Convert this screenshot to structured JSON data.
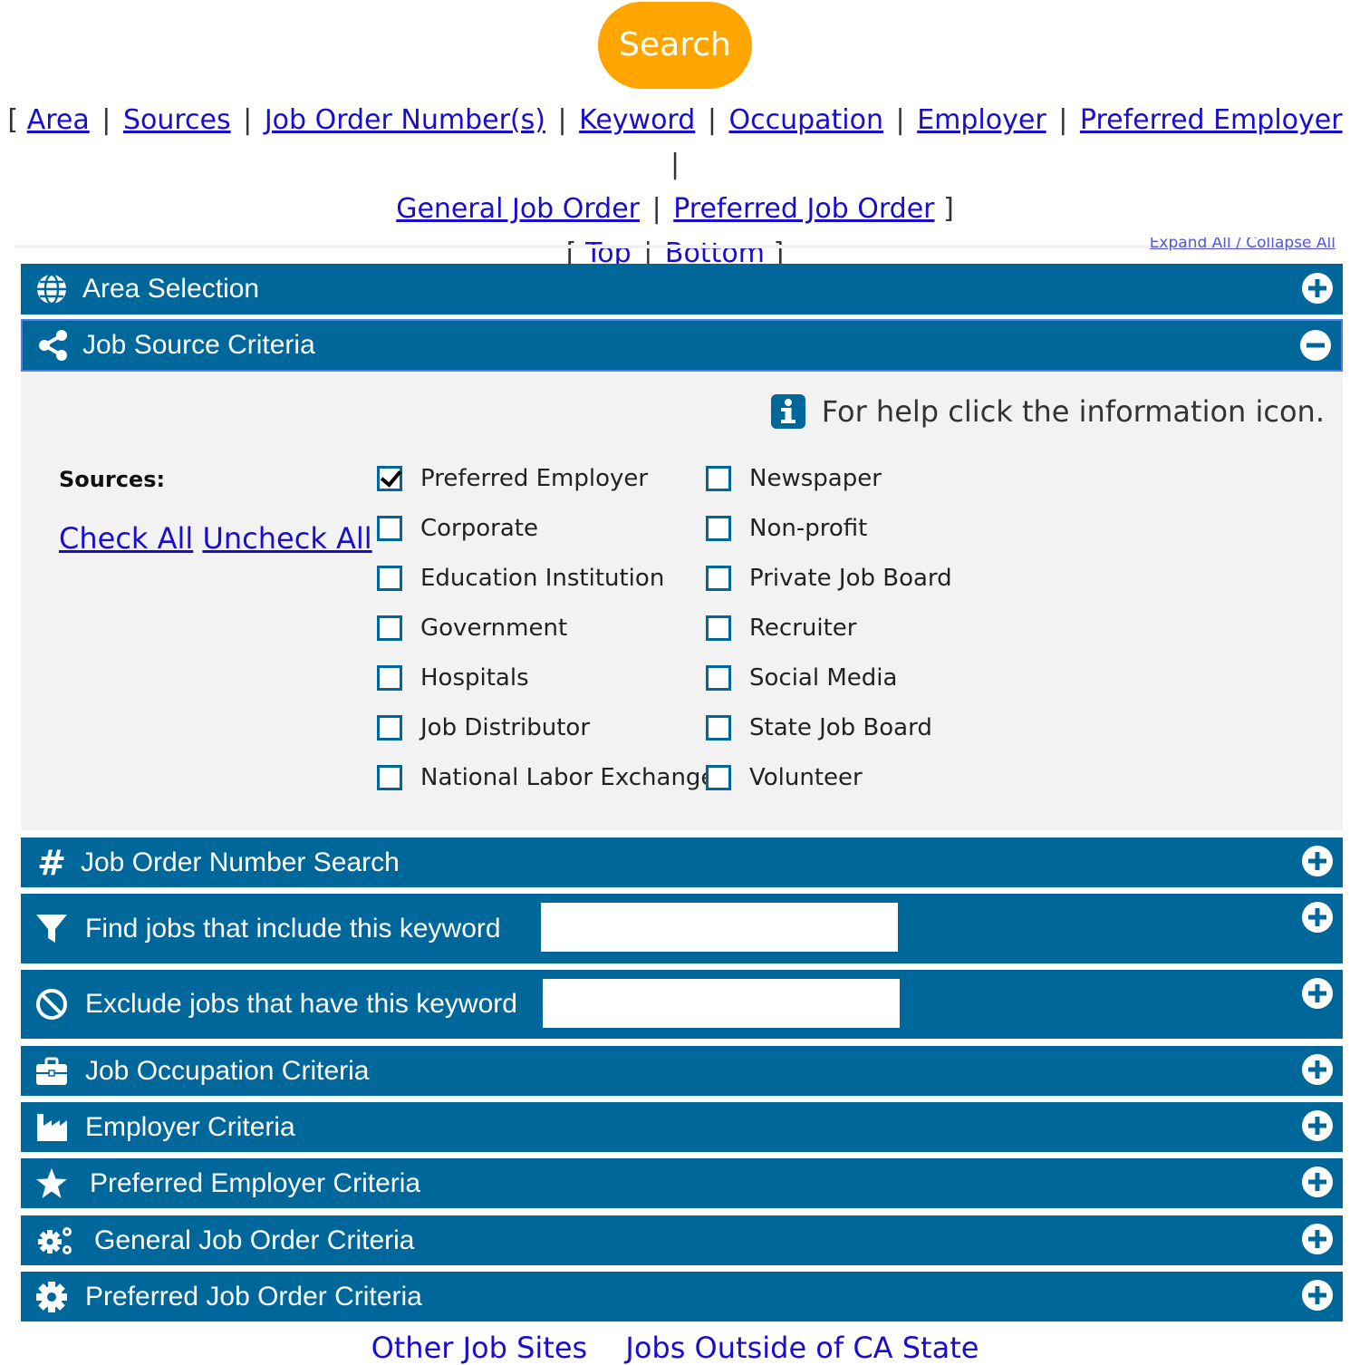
{
  "search_button": "Search",
  "nav": {
    "row1": [
      "Area",
      "Sources",
      "Job Order Number(s)",
      "Keyword",
      "Occupation",
      "Employer",
      "Preferred Employer"
    ],
    "row2": [
      "General Job Order",
      "Preferred Job Order"
    ],
    "row3": [
      "Top",
      "Bottom"
    ],
    "open_bracket": "[",
    "close_bracket": "]",
    "separator": "|"
  },
  "expand_collapse": "Expand All / Collapse All",
  "panels": {
    "area": {
      "title": "Area Selection",
      "icon": "globe-icon"
    },
    "job_source": {
      "title": "Job Source Criteria",
      "icon": "share-icon",
      "expanded": true
    },
    "job_order_number": {
      "title": "Job Order Number Search",
      "icon": "hash-icon"
    },
    "include_keyword": {
      "title": "Find jobs that include this keyword",
      "icon": "filter-icon",
      "value": ""
    },
    "exclude_keyword": {
      "title": "Exclude jobs that have this keyword",
      "icon": "ban-icon",
      "value": ""
    },
    "occupation": {
      "title": "Job Occupation Criteria",
      "icon": "briefcase-icon"
    },
    "employer": {
      "title": "Employer Criteria",
      "icon": "industry-icon"
    },
    "preferred_employer": {
      "title": "Preferred Employer Criteria",
      "icon": "star-icon"
    },
    "general_job_order": {
      "title": "General Job Order Criteria",
      "icon": "cogs-icon"
    },
    "preferred_job_order": {
      "title": "Preferred Job Order Criteria",
      "icon": "gear-icon"
    }
  },
  "job_source_body": {
    "help_text": "For help click the information icon.",
    "sources_label": "Sources:",
    "check_all": "Check All",
    "uncheck_all": "Uncheck All",
    "sources_col1": [
      {
        "label": "Preferred Employer",
        "checked": true
      },
      {
        "label": "Corporate",
        "checked": false
      },
      {
        "label": "Education Institution",
        "checked": false
      },
      {
        "label": "Government",
        "checked": false
      },
      {
        "label": "Hospitals",
        "checked": false
      },
      {
        "label": "Job Distributor",
        "checked": false
      },
      {
        "label": "National Labor Exchange",
        "checked": false
      }
    ],
    "sources_col2": [
      {
        "label": "Newspaper",
        "checked": false
      },
      {
        "label": "Non-profit",
        "checked": false
      },
      {
        "label": "Private Job Board",
        "checked": false
      },
      {
        "label": "Recruiter",
        "checked": false
      },
      {
        "label": "Social Media",
        "checked": false
      },
      {
        "label": "State Job Board",
        "checked": false
      },
      {
        "label": "Volunteer",
        "checked": false
      }
    ]
  },
  "footer_links": [
    "Other Job Sites",
    "Jobs Outside of CA State"
  ],
  "colors": {
    "panel": "#00679a",
    "search": "#ffa500",
    "link": "#1a0dcc",
    "body": "#f2f2f2"
  }
}
